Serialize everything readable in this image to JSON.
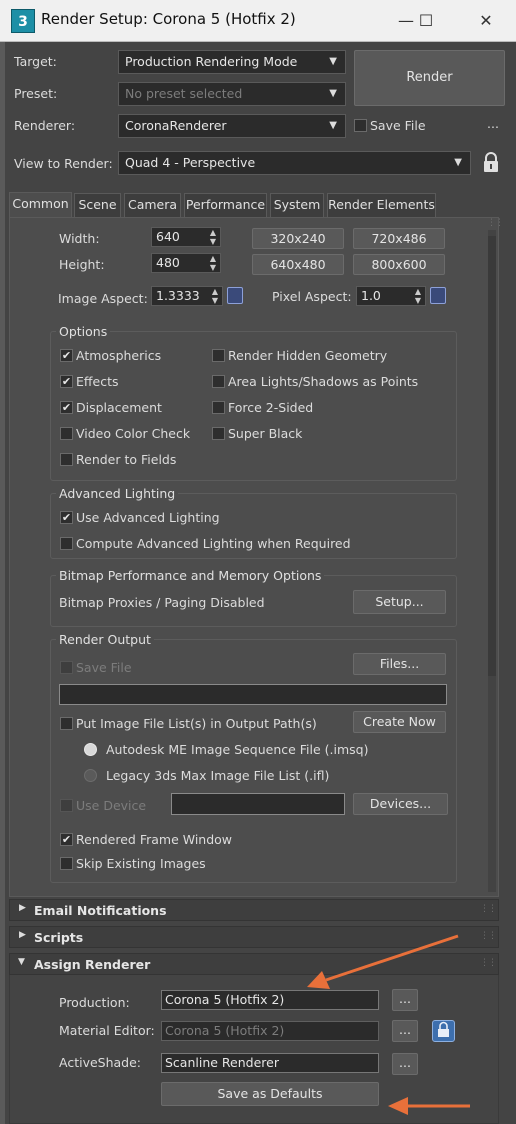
{
  "window": {
    "app_icon": "3",
    "title": "Render Setup: Corona 5 (Hotfix 2)",
    "minimize_icon": "minimize-icon",
    "maximize_icon": "maximize-icon",
    "close_icon": "close-icon"
  },
  "top": {
    "target_label": "Target:",
    "target_value": "Production Rendering Mode",
    "preset_label": "Preset:",
    "preset_value": "No preset selected",
    "renderer_label": "Renderer:",
    "renderer_value": "CoronaRenderer",
    "save_file_label": "Save File",
    "render_button": "Render",
    "more": "...",
    "view_label": "View to Render:",
    "view_value": "Quad 4 - Perspective"
  },
  "tabs": [
    "Common",
    "Scene",
    "Camera",
    "Performance",
    "System",
    "Render Elements"
  ],
  "output_size": {
    "width_label": "Width:",
    "width_value": "640",
    "height_label": "Height:",
    "height_value": "480",
    "presets": [
      "320x240",
      "720x486",
      "640x480",
      "800x600"
    ],
    "image_aspect_label": "Image Aspect:",
    "image_aspect_value": "1.3333",
    "pixel_aspect_label": "Pixel Aspect:",
    "pixel_aspect_value": "1.0"
  },
  "options": {
    "title": "Options",
    "left": [
      {
        "label": "Atmospherics",
        "checked": true
      },
      {
        "label": "Effects",
        "checked": true
      },
      {
        "label": "Displacement",
        "checked": true
      },
      {
        "label": "Video Color Check",
        "checked": false
      },
      {
        "label": "Render to Fields",
        "checked": false
      }
    ],
    "right": [
      {
        "label": "Render Hidden Geometry",
        "checked": false
      },
      {
        "label": "Area Lights/Shadows as Points",
        "checked": false
      },
      {
        "label": "Force 2-Sided",
        "checked": false
      },
      {
        "label": "Super Black",
        "checked": false
      }
    ]
  },
  "advanced_lighting": {
    "title": "Advanced Lighting",
    "use_label": "Use Advanced Lighting",
    "compute_label": "Compute Advanced Lighting when Required"
  },
  "bitmap": {
    "title": "Bitmap Performance and Memory Options",
    "status": "Bitmap Proxies / Paging Disabled",
    "setup_button": "Setup..."
  },
  "render_output": {
    "title": "Render Output",
    "save_file_label": "Save File",
    "files_button": "Files...",
    "path_value": "",
    "put_list_label": "Put Image File List(s) in Output Path(s)",
    "create_now_button": "Create Now",
    "radio_imsq": "Autodesk ME Image Sequence File (.imsq)",
    "radio_ifl": "Legacy 3ds Max Image File List (.ifl)",
    "use_device_label": "Use Device",
    "device_value": "",
    "devices_button": "Devices...",
    "rendered_frame_label": "Rendered Frame Window",
    "skip_existing_label": "Skip Existing Images"
  },
  "rollouts": {
    "email": "Email Notifications",
    "scripts": "Scripts",
    "assign": "Assign Renderer"
  },
  "assign": {
    "production_label": "Production:",
    "production_value": "Corona 5 (Hotfix 2)",
    "material_label": "Material Editor:",
    "material_value": "Corona 5 (Hotfix 2)",
    "activeshade_label": "ActiveShade:",
    "activeshade_value": "Scanline Renderer",
    "browse": "...",
    "save_defaults_button": "Save as Defaults"
  },
  "colors": {
    "annotation_arrow": "#e8703a",
    "background": "#444444"
  }
}
